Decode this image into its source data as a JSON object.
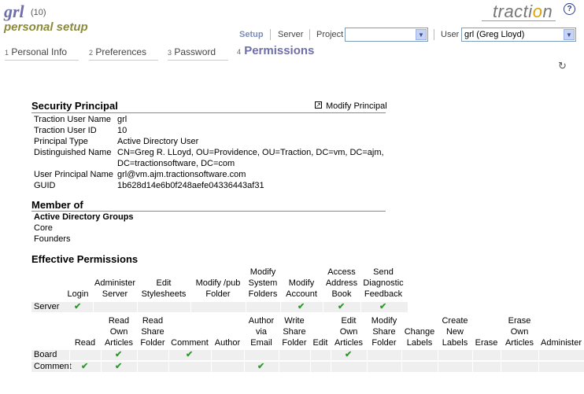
{
  "header": {
    "user_code": "grl",
    "user_id": "(10)",
    "page_heading": "personal setup",
    "logo_text_a": "tracti",
    "logo_text_o": "o",
    "logo_text_b": "n",
    "help_glyph": "?"
  },
  "nav": {
    "setup": "Setup",
    "server": "Server",
    "project": "Project",
    "project_value": "",
    "user": "User",
    "user_value": "grl (Greg Lloyd)"
  },
  "tabs": [
    {
      "num": "1",
      "label": "Personal Info"
    },
    {
      "num": "2",
      "label": "Preferences"
    },
    {
      "num": "3",
      "label": "Password"
    },
    {
      "num": "4",
      "label": "Permissions"
    }
  ],
  "security": {
    "title": "Security Principal",
    "modify_link": "Modify Principal",
    "rows": [
      {
        "label": "Traction User Name",
        "value": "grl"
      },
      {
        "label": "Traction User ID",
        "value": "10"
      },
      {
        "label": "Principal Type",
        "value": "Active Directory User"
      },
      {
        "label": "Distinguished Name",
        "value": "CN=Greg R. LLoyd, OU=Providence, OU=Traction, DC=vm, DC=ajm,",
        "value2": "DC=tractionsoftware, DC=com"
      },
      {
        "label": "User Principal Name",
        "value": "grl@vm.ajm.tractionsoftware.com"
      },
      {
        "label": "GUID",
        "value": "1b628d14e6b0f248aefe04336443af31"
      }
    ]
  },
  "member": {
    "title": "Member of",
    "group_heading": "Active Directory Groups",
    "groups": [
      "Core",
      "Founders"
    ]
  },
  "effective": {
    "title": "Effective Permissions",
    "server": {
      "row_label": "Server",
      "columns": [
        {
          "lines": [
            "Login"
          ],
          "checked": true
        },
        {
          "lines": [
            "Administer",
            "Server"
          ],
          "checked": false
        },
        {
          "lines": [
            "Edit",
            "Stylesheets"
          ],
          "checked": false
        },
        {
          "lines": [
            "Modify /pub",
            "Folder"
          ],
          "checked": false
        },
        {
          "lines": [
            "Modify",
            "System",
            "Folders"
          ],
          "checked": false
        },
        {
          "lines": [
            "Modify",
            "Account"
          ],
          "checked": true
        },
        {
          "lines": [
            "Access",
            "Address",
            "Book"
          ],
          "checked": true
        },
        {
          "lines": [
            "Send",
            "Diagnostic",
            "Feedback"
          ],
          "checked": true
        }
      ]
    },
    "project": {
      "row_labels": [
        "Board",
        "Comment"
      ],
      "columns": [
        {
          "lines": [
            "Read"
          ],
          "board": false,
          "comment": true
        },
        {
          "lines": [
            "Read",
            "Own",
            "Articles"
          ],
          "board": true,
          "comment": true
        },
        {
          "lines": [
            "Read",
            "Share",
            "Folder"
          ],
          "board": false,
          "comment": false
        },
        {
          "lines": [
            "Comment"
          ],
          "board": true,
          "comment": false
        },
        {
          "lines": [
            "Author"
          ],
          "board": false,
          "comment": false
        },
        {
          "lines": [
            "Author",
            "via",
            "Email"
          ],
          "board": false,
          "comment": true
        },
        {
          "lines": [
            "Write",
            "Share",
            "Folder"
          ],
          "board": false,
          "comment": false
        },
        {
          "lines": [
            "Edit"
          ],
          "board": false,
          "comment": false
        },
        {
          "lines": [
            "Edit",
            "Own",
            "Articles"
          ],
          "board": true,
          "comment": false
        },
        {
          "lines": [
            "Modify",
            "Share",
            "Folder"
          ],
          "board": false,
          "comment": false
        },
        {
          "lines": [
            "Change",
            "Labels"
          ],
          "board": false,
          "comment": false
        },
        {
          "lines": [
            "Create",
            "New",
            "Labels"
          ],
          "board": false,
          "comment": false
        },
        {
          "lines": [
            "Erase"
          ],
          "board": false,
          "comment": false
        },
        {
          "lines": [
            "Erase",
            "Own",
            "Articles"
          ],
          "board": false,
          "comment": false
        },
        {
          "lines": [
            "Administer"
          ],
          "board": false,
          "comment": false
        }
      ]
    },
    "check_glyph": "✔"
  }
}
